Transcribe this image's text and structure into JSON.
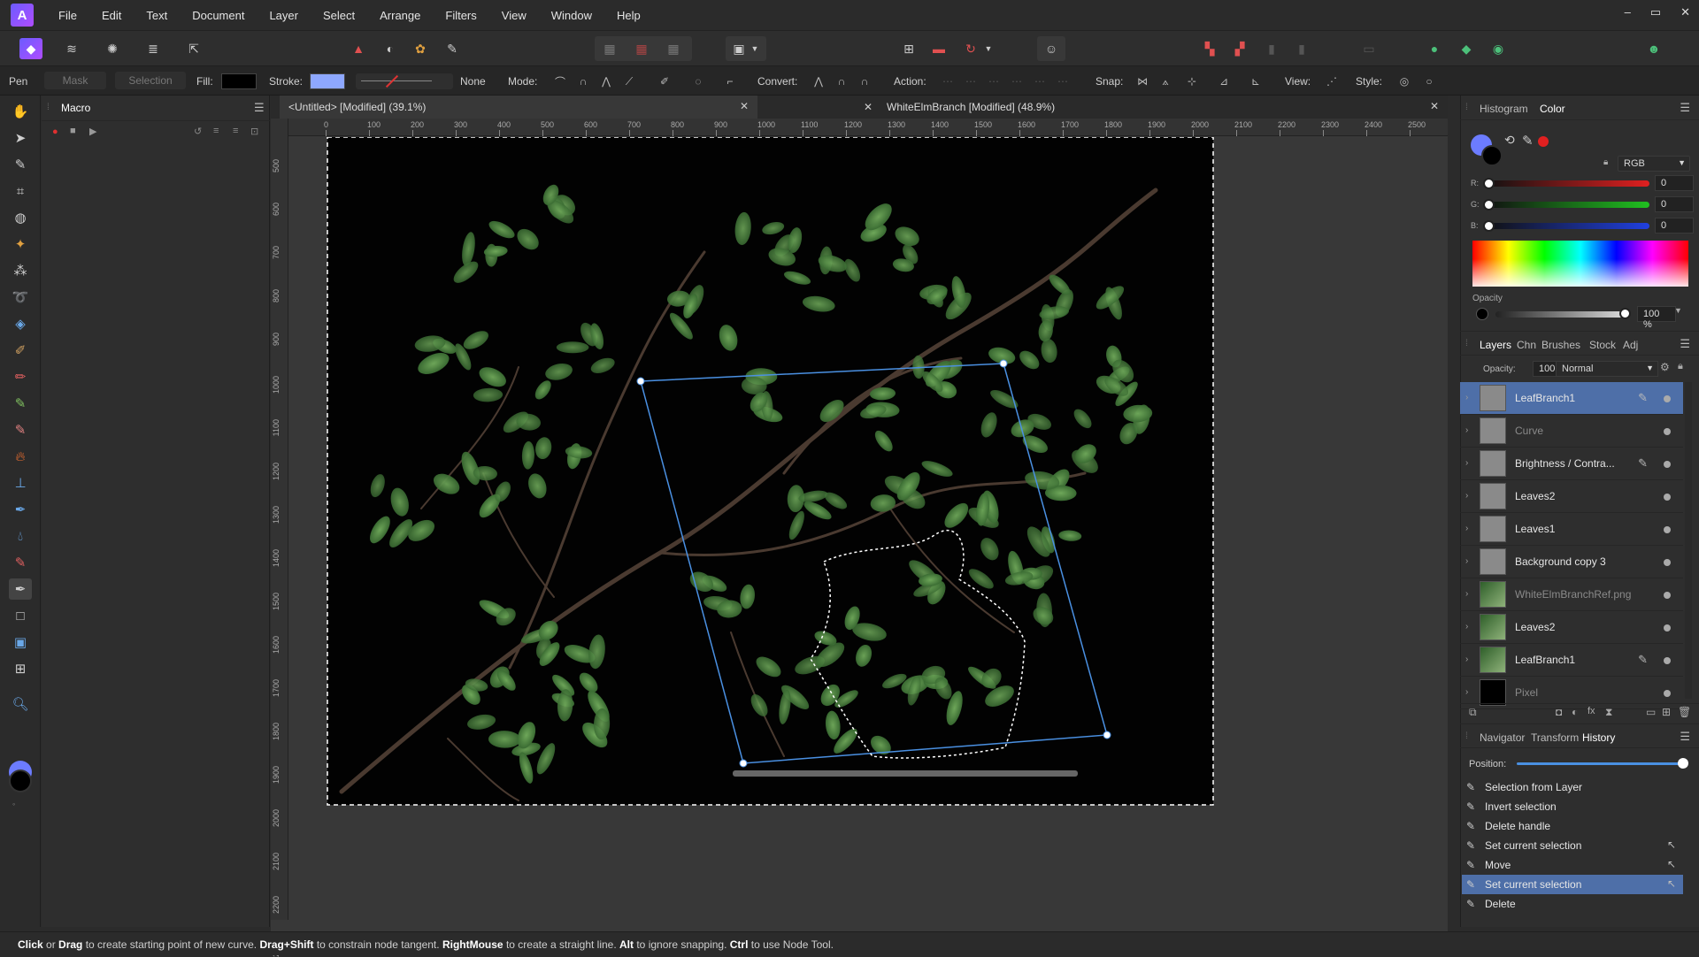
{
  "app": {
    "logo_glyph": "A",
    "menu": [
      "File",
      "Edit",
      "Text",
      "Document",
      "Layer",
      "Select",
      "Arrange",
      "Filters",
      "View",
      "Window",
      "Help"
    ],
    "window_controls": [
      "–",
      "▭",
      "✕"
    ]
  },
  "context_bar": {
    "tool_name": "Pen",
    "mask_label": "Mask",
    "selection_label": "Selection",
    "fill_label": "Fill:",
    "fill_color": "#000000",
    "stroke_label": "Stroke:",
    "stroke_color": "#8ea8ff",
    "stroke_style": "None",
    "mode_label": "Mode:",
    "convert_label": "Convert:",
    "action_label": "Action:",
    "snap_label": "Snap:",
    "view_label": "View:",
    "style_label": "Style:"
  },
  "macro_panel": {
    "title": "Macro"
  },
  "documents": [
    {
      "title": "<Untitled> [Modified] (39.1%)"
    },
    {
      "title": "WhiteElmBranch [Modified] (48.9%)"
    }
  ],
  "rulers": {
    "unit": "px",
    "h_ticks": [
      "0",
      "100",
      "200",
      "300",
      "400",
      "500",
      "600",
      "700",
      "800",
      "900",
      "1000",
      "1100",
      "1200",
      "1300",
      "1400",
      "1500",
      "1600",
      "1700",
      "1800",
      "1900",
      "2000",
      "2100",
      "2200",
      "2300",
      "2400",
      "2500"
    ],
    "v_ticks": [
      "500",
      "600",
      "700",
      "800",
      "900",
      "1000",
      "1100",
      "1200",
      "1300",
      "1400",
      "1500",
      "1600",
      "1700",
      "1800",
      "1900",
      "2000",
      "2100",
      "2200",
      "2300"
    ]
  },
  "color_panel": {
    "tabs": [
      "Histogram",
      "Color"
    ],
    "active_tab": "Color",
    "model": "RGB",
    "channels": [
      {
        "label": "R:",
        "value": "0",
        "color": "#e02020"
      },
      {
        "label": "G:",
        "value": "0",
        "color": "#20c020"
      },
      {
        "label": "B:",
        "value": "0",
        "color": "#2040e0"
      }
    ],
    "opacity_label": "Opacity",
    "opacity_value": "100 %",
    "accent_swatch": "#6c7cff",
    "secondary_swatch": "#000000"
  },
  "layers_panel": {
    "tabs": [
      "Layers",
      "Chn",
      "Brushes",
      "Stock",
      "Adj"
    ],
    "active_tab": "Layers",
    "opacity_label": "Opacity:",
    "opacity_value": "100 %",
    "blend_mode": "Normal",
    "layers": [
      {
        "name": "LeafBranch1",
        "selected": true,
        "dim": false,
        "brush": true
      },
      {
        "name": "Curve",
        "selected": false,
        "dim": true,
        "brush": false
      },
      {
        "name": "Brightness / Contra...",
        "selected": false,
        "dim": false,
        "brush": true
      },
      {
        "name": "Leaves2",
        "selected": false,
        "dim": false,
        "brush": false
      },
      {
        "name": "Leaves1",
        "selected": false,
        "dim": false,
        "brush": false
      },
      {
        "name": "Background copy 3",
        "selected": false,
        "dim": false,
        "brush": false
      },
      {
        "name": "WhiteElmBranchRef.png",
        "selected": false,
        "dim": true,
        "brush": false
      },
      {
        "name": "Leaves2",
        "selected": false,
        "dim": false,
        "brush": false
      },
      {
        "name": "LeafBranch1",
        "selected": false,
        "dim": false,
        "brush": true
      },
      {
        "name": "Pixel",
        "selected": false,
        "dim": true,
        "brush": false
      }
    ]
  },
  "history_panel": {
    "tabs": [
      "Navigator",
      "Transform",
      "History"
    ],
    "active_tab": "History",
    "position_label": "Position:",
    "items": [
      {
        "label": "Selection from Layer",
        "selected": false,
        "node": false
      },
      {
        "label": "Invert selection",
        "selected": false,
        "node": false
      },
      {
        "label": "Delete handle",
        "selected": false,
        "node": false
      },
      {
        "label": "Set current selection",
        "selected": false,
        "node": true
      },
      {
        "label": "Move",
        "selected": false,
        "node": true
      },
      {
        "label": "Set current selection",
        "selected": true,
        "node": true
      },
      {
        "label": "Delete",
        "selected": false,
        "node": false
      }
    ]
  },
  "status_bar": {
    "segments": [
      {
        "bold": true,
        "text": "Click"
      },
      {
        "bold": false,
        "text": " or "
      },
      {
        "bold": true,
        "text": "Drag"
      },
      {
        "bold": false,
        "text": " to create starting point of new curve. "
      },
      {
        "bold": true,
        "text": "Drag+Shift"
      },
      {
        "bold": false,
        "text": " to constrain node tangent. "
      },
      {
        "bold": true,
        "text": "RightMouse"
      },
      {
        "bold": false,
        "text": " to create a straight line. "
      },
      {
        "bold": true,
        "text": "Alt"
      },
      {
        "bold": false,
        "text": " to ignore snapping. "
      },
      {
        "bold": true,
        "text": "Ctrl"
      },
      {
        "bold": false,
        "text": " to use Node Tool."
      }
    ]
  }
}
